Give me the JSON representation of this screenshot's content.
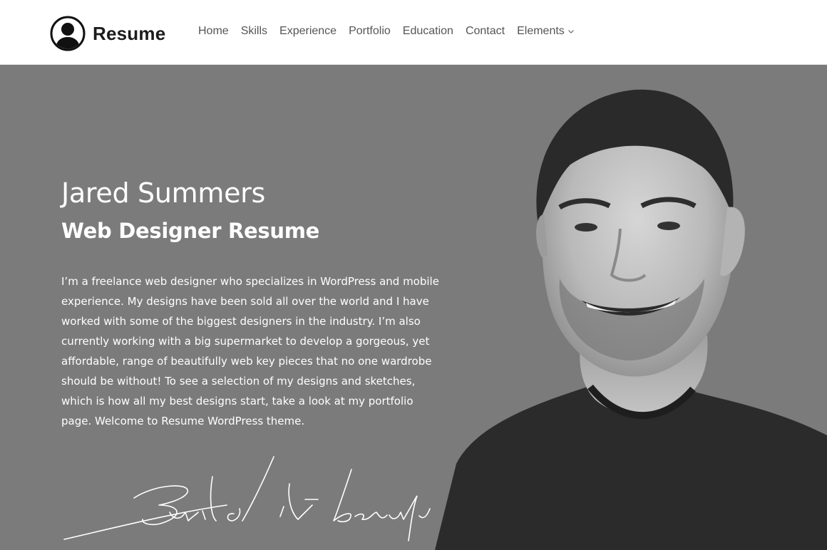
{
  "header": {
    "logo_text": "Resume",
    "logo_icon": "user-avatar-icon",
    "nav": [
      {
        "label": "Home"
      },
      {
        "label": "Skills"
      },
      {
        "label": "Experience"
      },
      {
        "label": "Portfolio"
      },
      {
        "label": "Education"
      },
      {
        "label": "Contact"
      },
      {
        "label": "Elements",
        "icon": "chevron-down-icon"
      }
    ]
  },
  "hero": {
    "name": "Jared Summers",
    "subtitle": "Web Designer Resume",
    "bio": "I’m a freelance web designer who specializes in WordPress and mobile experience. My designs have been sold all over the world and I have worked with some of the biggest designers in the industry. I’m also currently working with a big supermarket to develop a gorgeous, yet affordable, range of beautifully web key pieces that no one wardrobe should be without! To see a selection of my designs and sketches, which is how all my best designs start, take a look at my portfolio page. Welcome to Resume WordPress theme.",
    "signature": "Build it beautiful"
  },
  "colors": {
    "header_bg": "#ffffff",
    "hero_bg": "#7b7b7b",
    "text_light": "#ffffff",
    "nav_text": "#555555"
  }
}
